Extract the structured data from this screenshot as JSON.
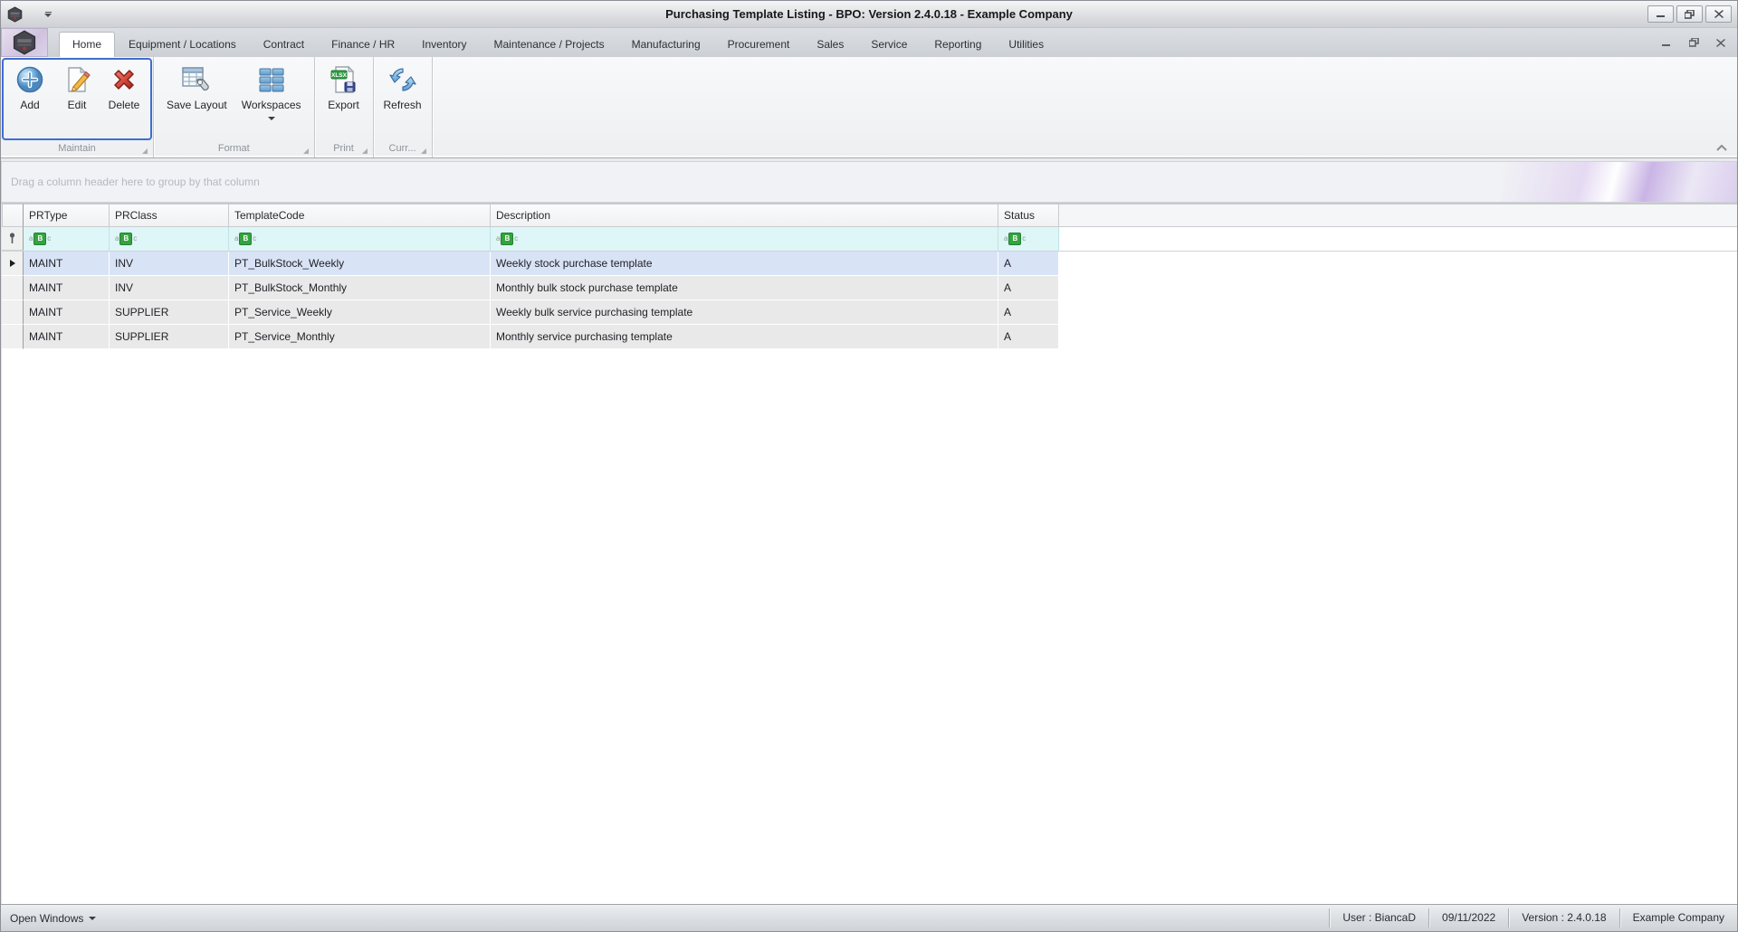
{
  "titlebar": {
    "title": "Purchasing Template Listing - BPO: Version 2.4.0.18 - Example Company"
  },
  "tabs": {
    "items": [
      "Home",
      "Equipment / Locations",
      "Contract",
      "Finance / HR",
      "Inventory",
      "Maintenance / Projects",
      "Manufacturing",
      "Procurement",
      "Sales",
      "Service",
      "Reporting",
      "Utilities"
    ],
    "selected": "Home"
  },
  "ribbon": {
    "buttons": {
      "add": "Add",
      "edit": "Edit",
      "delete": "Delete",
      "save_layout": "Save Layout",
      "workspaces": "Workspaces",
      "export": "Export",
      "refresh": "Refresh"
    },
    "groups": {
      "maintain": "Maintain",
      "format": "Format",
      "print": "Print",
      "current": "Curr..."
    }
  },
  "group_by_hint": "Drag a column header here to group by that column",
  "grid": {
    "columns": [
      "PRType",
      "PRClass",
      "TemplateCode",
      "Description",
      "Status"
    ],
    "rows": [
      [
        "MAINT",
        "INV",
        "PT_BulkStock_Weekly",
        "Weekly stock purchase template",
        "A"
      ],
      [
        "MAINT",
        "INV",
        "PT_BulkStock_Monthly",
        "Monthly bulk stock purchase template",
        "A"
      ],
      [
        "MAINT",
        "SUPPLIER",
        "PT_Service_Weekly",
        "Weekly bulk service purchasing template",
        "A"
      ],
      [
        "MAINT",
        "SUPPLIER",
        "PT_Service_Monthly",
        "Monthly service purchasing template",
        "A"
      ]
    ],
    "selected_row_index": 0
  },
  "statusbar": {
    "open_windows": "Open Windows",
    "user": "User : BiancaD",
    "date": "09/11/2022",
    "version": "Version : 2.4.0.18",
    "company": "Example Company"
  },
  "colors": {
    "maintain_outline_blue": "#3f6ecf",
    "filter_row_bg": "#def6f8",
    "selected_row_bg": "#d9e3f6",
    "abc_icon_green": "#35a33f",
    "band_swoosh_lavender": "#bca0e0"
  }
}
